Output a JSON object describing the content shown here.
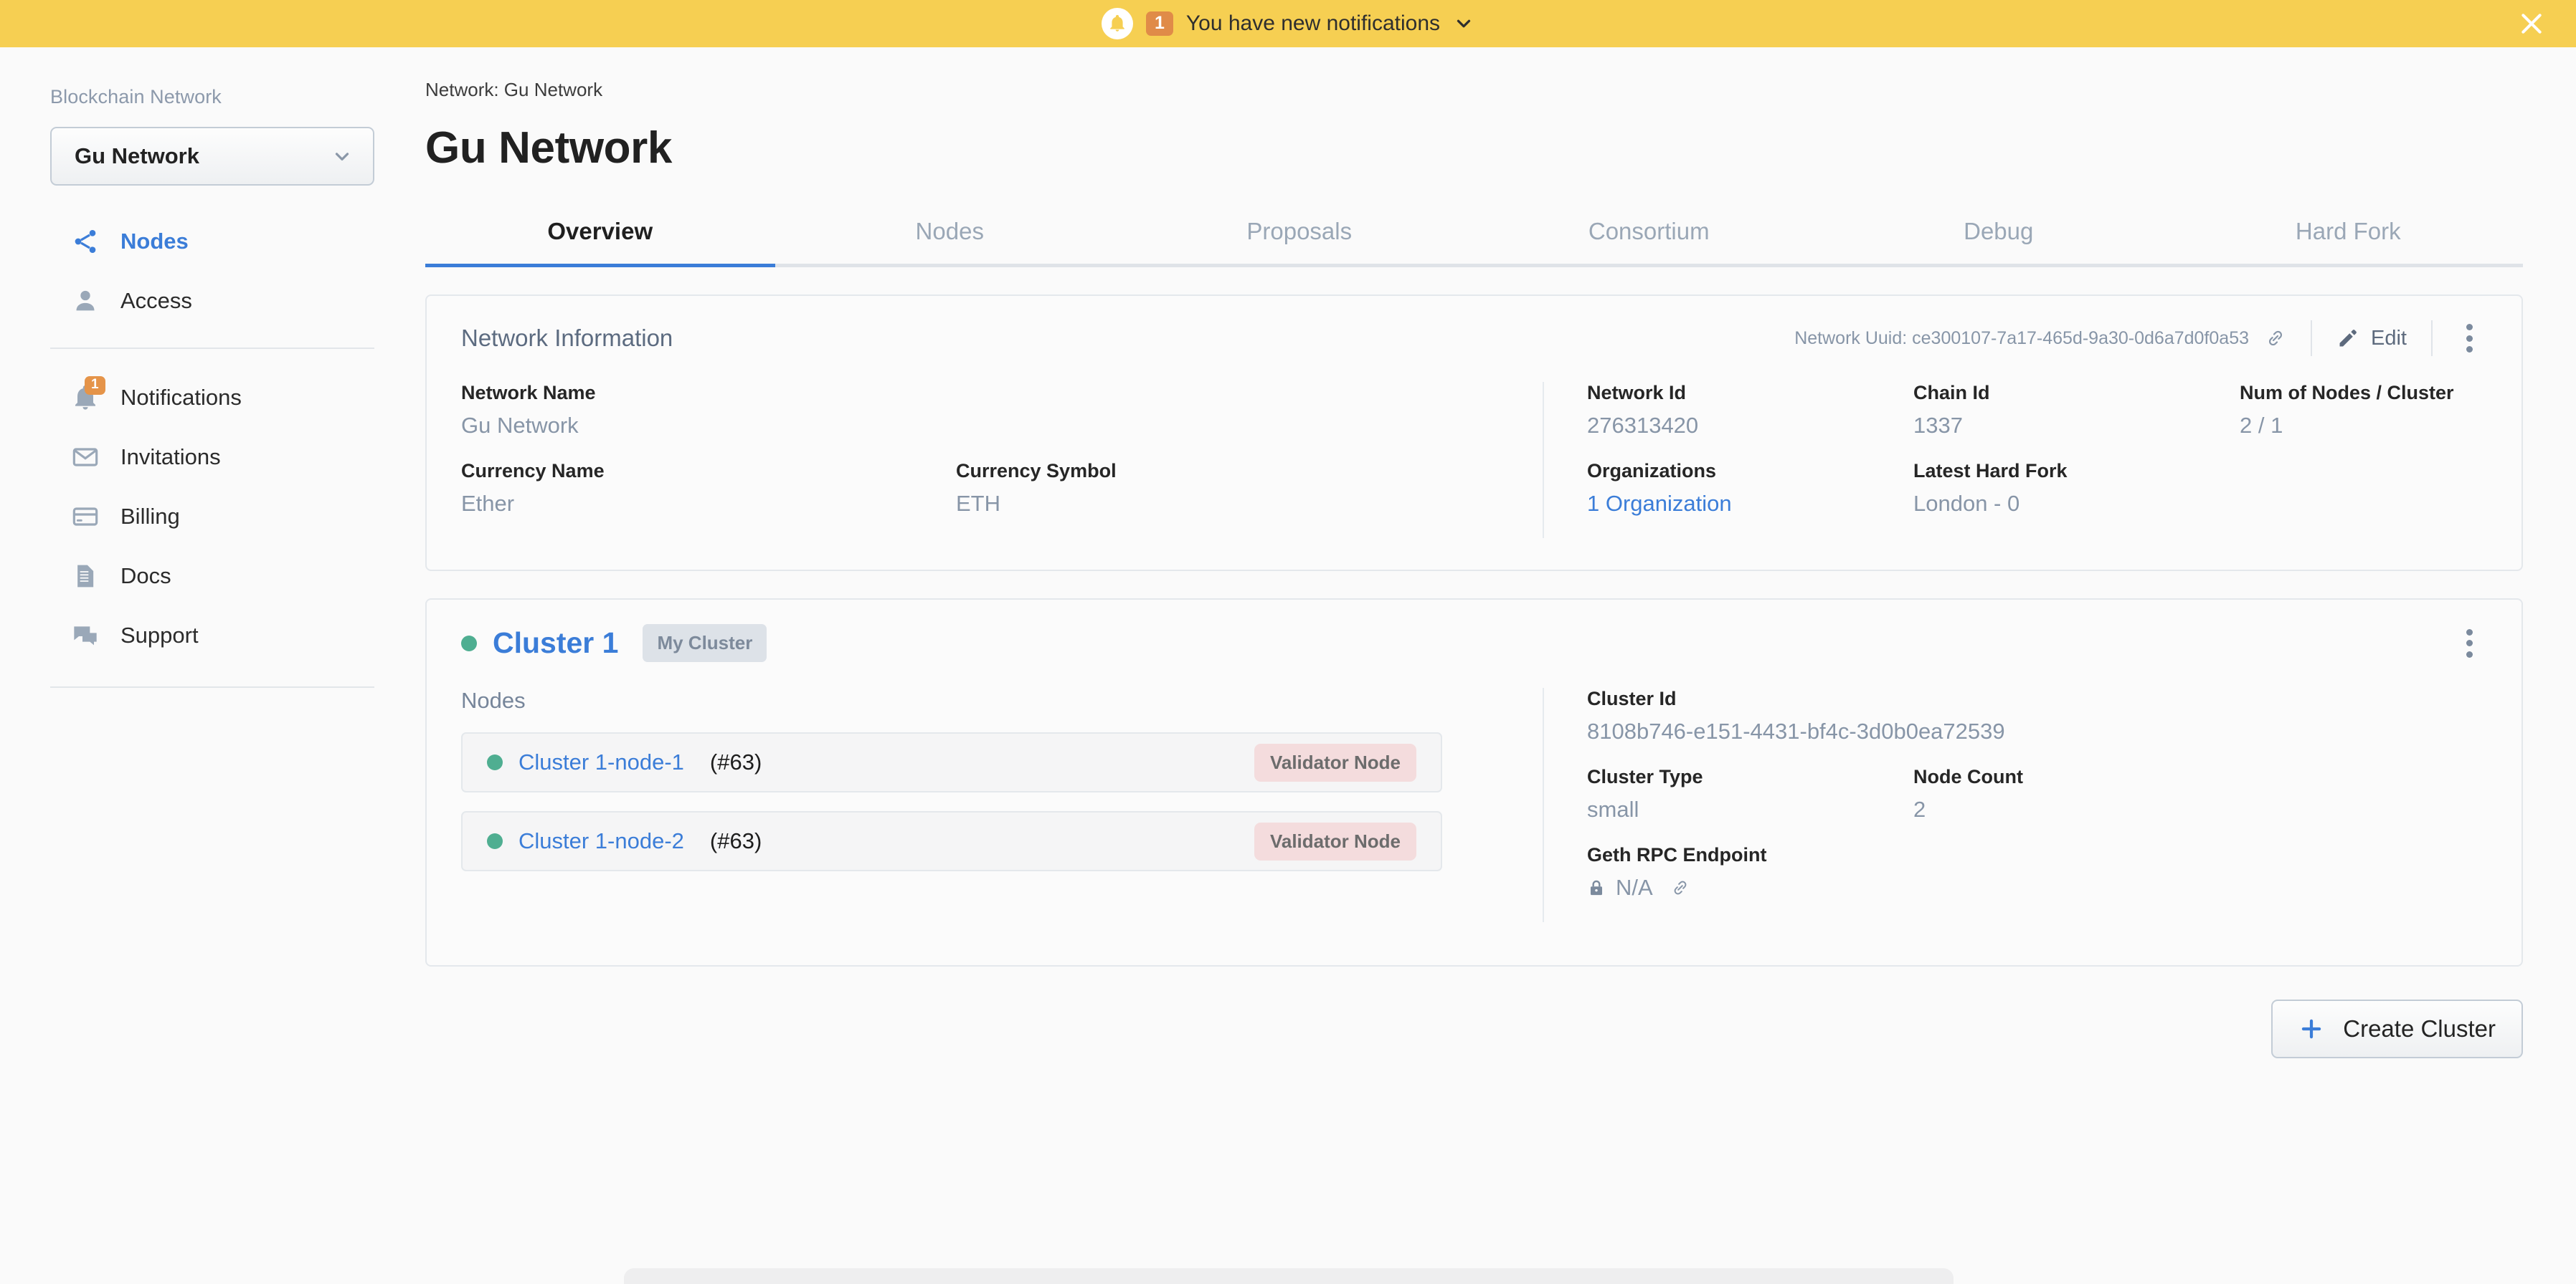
{
  "banner": {
    "badge": "1",
    "text": "You have new notifications",
    "bell_icon": "bell-icon",
    "chevron_icon": "chevron-down-icon",
    "close_icon": "close-icon",
    "bg_color": "#f6cf52",
    "badge_color": "#e08b48"
  },
  "sidebar": {
    "section_label": "Blockchain Network",
    "network_select": {
      "value": "Gu Network",
      "chevron_icon": "chevron-down-icon"
    },
    "primary_items": [
      {
        "label": "Nodes",
        "icon": "share-nodes-icon",
        "active": true
      },
      {
        "label": "Access",
        "icon": "person-icon",
        "active": false
      }
    ],
    "secondary_items": [
      {
        "label": "Notifications",
        "icon": "bell-icon",
        "badge": "1"
      },
      {
        "label": "Invitations",
        "icon": "envelope-icon",
        "badge": ""
      },
      {
        "label": "Billing",
        "icon": "credit-card-icon",
        "badge": ""
      },
      {
        "label": "Docs",
        "icon": "document-icon",
        "badge": ""
      },
      {
        "label": "Support",
        "icon": "chat-icon",
        "badge": ""
      }
    ]
  },
  "main": {
    "breadcrumb": "Network: Gu Network",
    "page_title": "Gu Network",
    "tabs": [
      {
        "label": "Overview",
        "active": true
      },
      {
        "label": "Nodes",
        "active": false
      },
      {
        "label": "Proposals",
        "active": false
      },
      {
        "label": "Consortium",
        "active": false
      },
      {
        "label": "Debug",
        "active": false
      },
      {
        "label": "Hard Fork",
        "active": false
      }
    ]
  },
  "network_info": {
    "title": "Network Information",
    "uuid_label": "Network Uuid: ce300107-7a17-465d-9a30-0d6a7d0f0a53",
    "copy_icon": "link-icon",
    "edit_label": "Edit",
    "edit_icon": "pencil-icon",
    "menu_icon": "kebab-menu-icon",
    "fields": {
      "network_name": {
        "label": "Network Name",
        "value": "Gu Network"
      },
      "currency_name": {
        "label": "Currency Name",
        "value": "Ether"
      },
      "currency_symbol": {
        "label": "Currency Symbol",
        "value": "ETH"
      },
      "network_id": {
        "label": "Network Id",
        "value": "276313420"
      },
      "chain_id": {
        "label": "Chain Id",
        "value": "1337"
      },
      "num_nodes_cluster": {
        "label": "Num of Nodes / Cluster",
        "value": "2 / 1"
      },
      "organizations": {
        "label": "Organizations",
        "value": "1 Organization"
      },
      "latest_hard_fork": {
        "label": "Latest Hard Fork",
        "value": "London - 0"
      }
    }
  },
  "cluster": {
    "name": "Cluster 1",
    "badge": "My Cluster",
    "status_color": "#4fae91",
    "menu_icon": "kebab-menu-icon",
    "nodes_label": "Nodes",
    "nodes": [
      {
        "name": "Cluster 1-node-1",
        "number": "(#63)",
        "role": "Validator Node"
      },
      {
        "name": "Cluster 1-node-2",
        "number": "(#63)",
        "role": "Validator Node"
      }
    ],
    "details": {
      "cluster_id": {
        "label": "Cluster Id",
        "value": "8108b746-e151-4431-bf4c-3d0b0ea72539"
      },
      "cluster_type": {
        "label": "Cluster Type",
        "value": "small"
      },
      "node_count": {
        "label": "Node Count",
        "value": "2"
      },
      "geth_rpc": {
        "label": "Geth RPC Endpoint",
        "value": "N/A",
        "lock_icon": "lock-icon",
        "copy_icon": "link-icon"
      }
    }
  },
  "footer": {
    "create_cluster_label": "Create Cluster",
    "plus_icon": "plus-icon"
  }
}
